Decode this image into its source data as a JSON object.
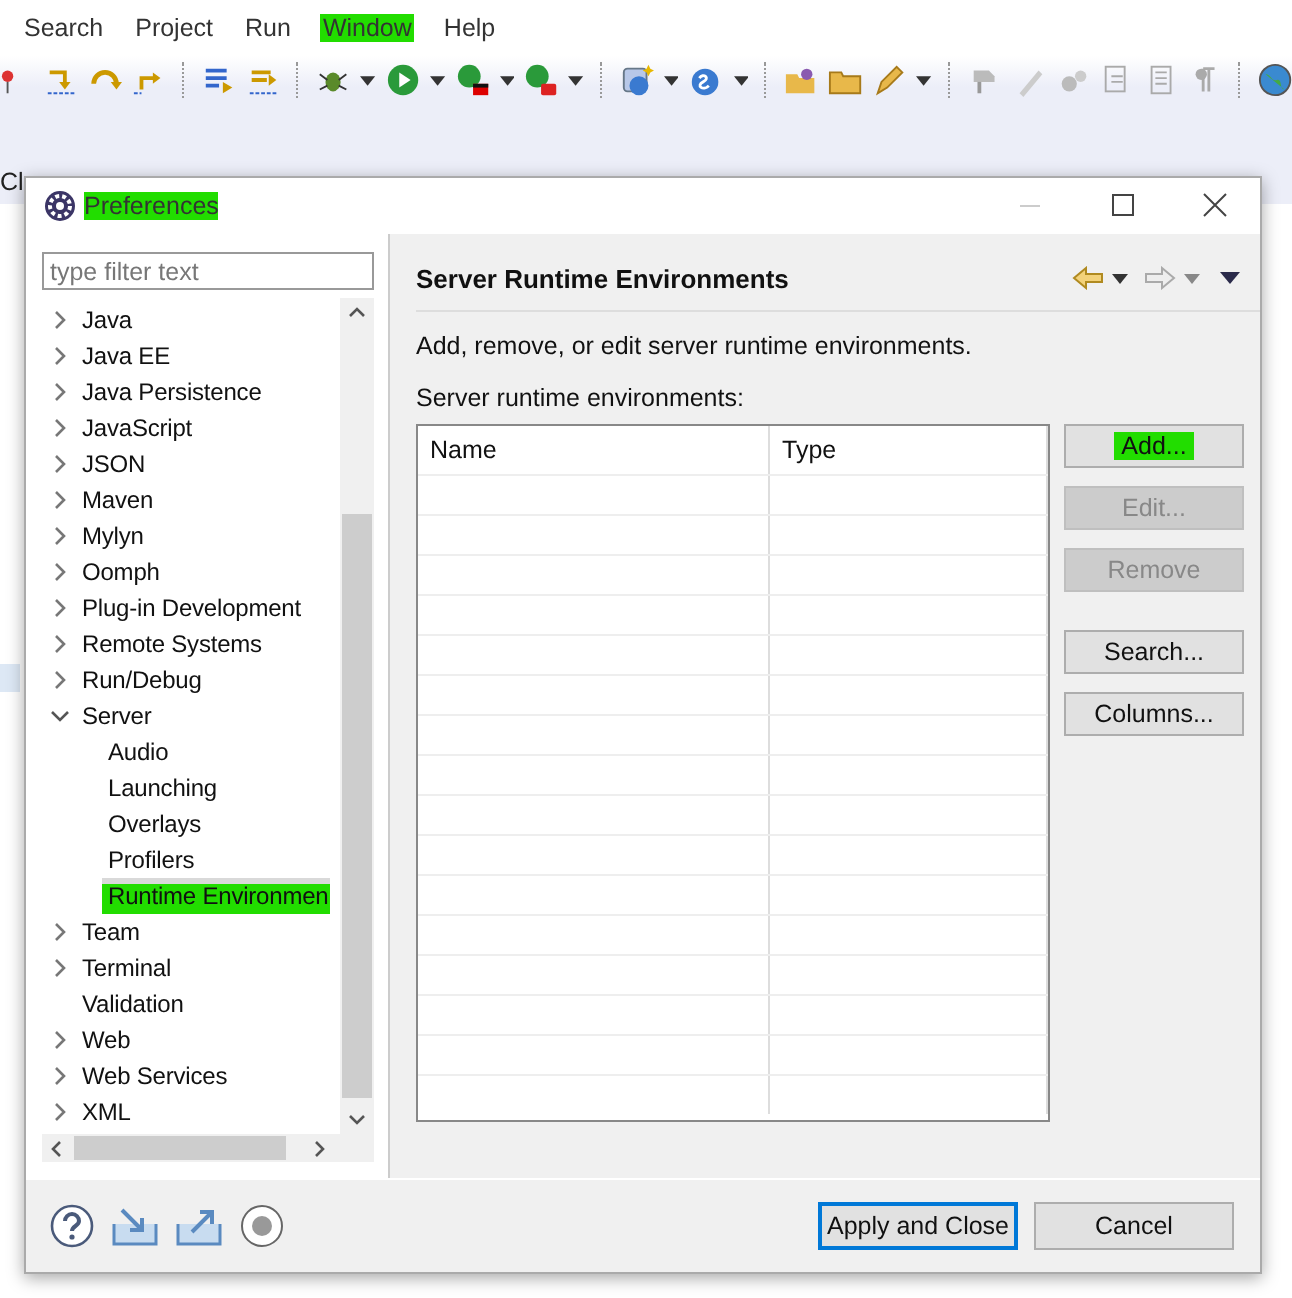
{
  "menu": [
    {
      "label": "Search",
      "highlighted": false
    },
    {
      "label": "Project",
      "highlighted": false
    },
    {
      "label": "Run",
      "highlighted": false
    },
    {
      "label": "Window",
      "highlighted": true
    },
    {
      "label": "Help",
      "highlighted": false
    }
  ],
  "editor_tab": {
    "label": "Cl"
  },
  "dialog": {
    "title": "Preferences",
    "title_highlighted": true,
    "filter": {
      "placeholder": "type filter text"
    },
    "tree": [
      {
        "label": "Java",
        "expandable": true,
        "expanded": false,
        "selected": false,
        "highlighted": false
      },
      {
        "label": "Java EE",
        "expandable": true,
        "expanded": false,
        "selected": false,
        "highlighted": false
      },
      {
        "label": "Java Persistence",
        "expandable": true,
        "expanded": false,
        "selected": false,
        "highlighted": false
      },
      {
        "label": "JavaScript",
        "expandable": true,
        "expanded": false,
        "selected": false,
        "highlighted": false
      },
      {
        "label": "JSON",
        "expandable": true,
        "expanded": false,
        "selected": false,
        "highlighted": false
      },
      {
        "label": "Maven",
        "expandable": true,
        "expanded": false,
        "selected": false,
        "highlighted": false
      },
      {
        "label": "Mylyn",
        "expandable": true,
        "expanded": false,
        "selected": false,
        "highlighted": false
      },
      {
        "label": "Oomph",
        "expandable": true,
        "expanded": false,
        "selected": false,
        "highlighted": false
      },
      {
        "label": "Plug-in Development",
        "expandable": true,
        "expanded": false,
        "selected": false,
        "highlighted": false
      },
      {
        "label": "Remote Systems",
        "expandable": true,
        "expanded": false,
        "selected": false,
        "highlighted": false
      },
      {
        "label": "Run/Debug",
        "expandable": true,
        "expanded": false,
        "selected": false,
        "highlighted": false
      },
      {
        "label": "Server",
        "expandable": true,
        "expanded": true,
        "selected": false,
        "highlighted": false,
        "children": [
          {
            "label": "Audio",
            "expandable": false,
            "selected": false,
            "highlighted": false
          },
          {
            "label": "Launching",
            "expandable": false,
            "selected": false,
            "highlighted": false
          },
          {
            "label": "Overlays",
            "expandable": false,
            "selected": false,
            "highlighted": false
          },
          {
            "label": "Profilers",
            "expandable": false,
            "selected": false,
            "highlighted": false
          },
          {
            "label": "Runtime Environmen",
            "expandable": false,
            "selected": true,
            "highlighted": true
          }
        ]
      },
      {
        "label": "Team",
        "expandable": true,
        "expanded": false,
        "selected": false,
        "highlighted": false
      },
      {
        "label": "Terminal",
        "expandable": true,
        "expanded": false,
        "selected": false,
        "highlighted": false
      },
      {
        "label": "Validation",
        "expandable": false,
        "selected": false,
        "highlighted": false
      },
      {
        "label": "Web",
        "expandable": true,
        "expanded": false,
        "selected": false,
        "highlighted": false
      },
      {
        "label": "Web Services",
        "expandable": true,
        "expanded": false,
        "selected": false,
        "highlighted": false
      },
      {
        "label": "XML",
        "expandable": true,
        "expanded": false,
        "selected": false,
        "highlighted": false
      }
    ],
    "page": {
      "title": "Server Runtime Environments",
      "description": "Add, remove, or edit server runtime environments.",
      "list_label": "Server runtime environments:",
      "table": {
        "columns": [
          "Name",
          "Type"
        ]
      },
      "button_groups": [
        {
          "buttons": [
            {
              "label": "Add...",
              "disabled": false,
              "highlighted": true
            },
            {
              "label": "Edit...",
              "disabled": true,
              "highlighted": false
            },
            {
              "label": "Remove",
              "disabled": true,
              "highlighted": false
            }
          ]
        },
        {
          "buttons": [
            {
              "label": "Search...",
              "disabled": false,
              "highlighted": false
            },
            {
              "label": "Columns...",
              "disabled": false,
              "highlighted": false
            }
          ]
        }
      ]
    },
    "footer_buttons": [
      {
        "label": "Apply and Close",
        "default": true
      },
      {
        "label": "Cancel",
        "default": false
      }
    ]
  }
}
